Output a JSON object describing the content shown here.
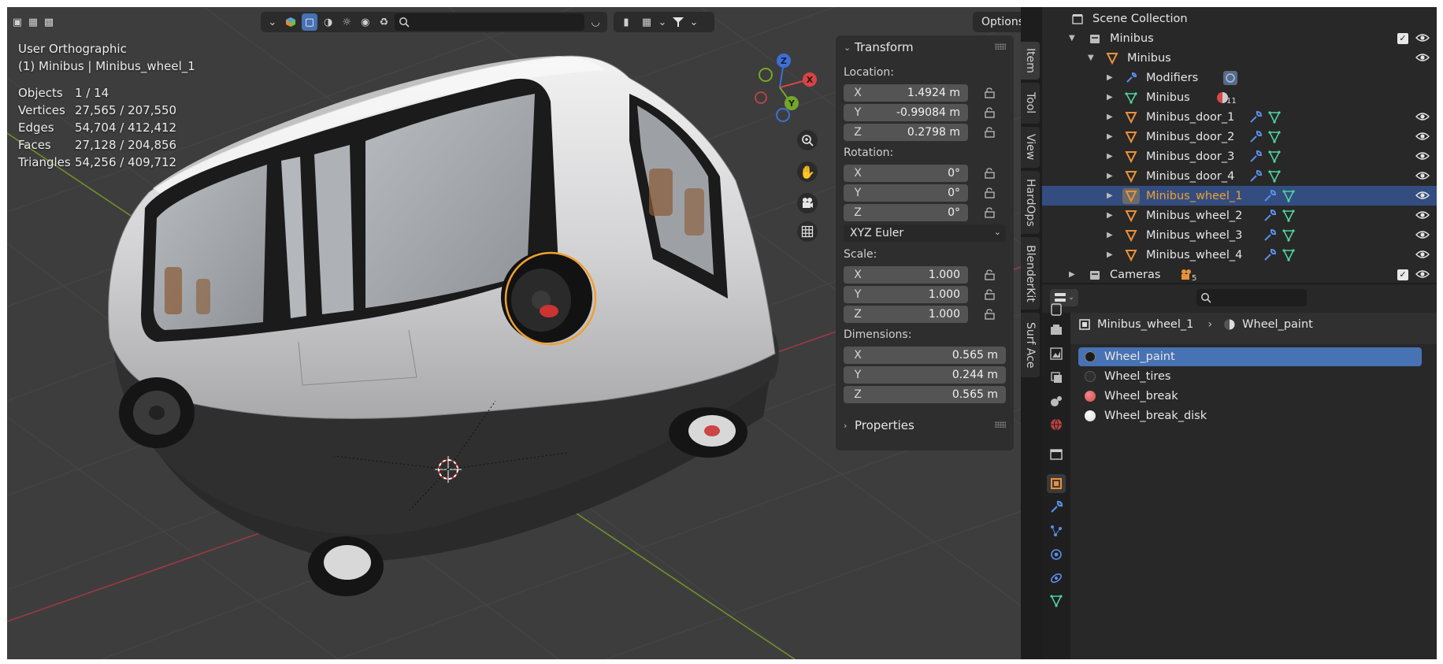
{
  "viewport": {
    "view_name": "User Orthographic",
    "active_object": "(1) Minibus | Minibus_wheel_1",
    "stats": [
      {
        "key": "Objects",
        "value": "1 / 14"
      },
      {
        "key": "Vertices",
        "value": "27,565 / 207,550"
      },
      {
        "key": "Edges",
        "value": "54,704 / 412,412"
      },
      {
        "key": "Faces",
        "value": "27,128 / 204,856"
      },
      {
        "key": "Triangles",
        "value": "54,256 / 409,712"
      }
    ],
    "options_label": "Options",
    "gizmo": {
      "x": "X",
      "y": "Y",
      "z": "Z"
    }
  },
  "npanel": {
    "transform_title": "Transform",
    "location_label": "Location:",
    "location": [
      {
        "axis": "X",
        "value": "1.4924 m"
      },
      {
        "axis": "Y",
        "value": "-0.99084 m"
      },
      {
        "axis": "Z",
        "value": "0.2798 m"
      }
    ],
    "rotation_label": "Rotation:",
    "rotation": [
      {
        "axis": "X",
        "value": "0°"
      },
      {
        "axis": "Y",
        "value": "0°"
      },
      {
        "axis": "Z",
        "value": "0°"
      }
    ],
    "rotation_mode": "XYZ Euler",
    "scale_label": "Scale:",
    "scale": [
      {
        "axis": "X",
        "value": "1.000"
      },
      {
        "axis": "Y",
        "value": "1.000"
      },
      {
        "axis": "Z",
        "value": "1.000"
      }
    ],
    "dimensions_label": "Dimensions:",
    "dimensions": [
      {
        "axis": "X",
        "value": "0.565 m"
      },
      {
        "axis": "Y",
        "value": "0.244 m"
      },
      {
        "axis": "Z",
        "value": "0.565 m"
      }
    ],
    "properties_title": "Properties"
  },
  "side_tabs": [
    "Item",
    "Tool",
    "View",
    "HardOps",
    "BlenderKit",
    "Surf Ace"
  ],
  "outliner": {
    "rows": [
      {
        "label": "Scene Collection"
      },
      {
        "label": "Minibus"
      },
      {
        "label": "Minibus"
      },
      {
        "label": "Modifiers"
      },
      {
        "label": "Minibus",
        "badge": "11"
      },
      {
        "label": "Minibus_door_1"
      },
      {
        "label": "Minibus_door_2"
      },
      {
        "label": "Minibus_door_3"
      },
      {
        "label": "Minibus_door_4"
      },
      {
        "label": "Minibus_wheel_1"
      },
      {
        "label": "Minibus_wheel_2"
      },
      {
        "label": "Minibus_wheel_3"
      },
      {
        "label": "Minibus_wheel_4"
      },
      {
        "label": "Cameras",
        "badge": "5"
      }
    ]
  },
  "properties": {
    "breadcrumb_object": "Minibus_wheel_1",
    "breadcrumb_material": "Wheel_paint",
    "materials": [
      {
        "name": "Wheel_paint",
        "color": "#1c1c1c"
      },
      {
        "name": "Wheel_tires",
        "color": "#303030"
      },
      {
        "name": "Wheel_break",
        "color": "#d94848"
      },
      {
        "name": "Wheel_break_disk",
        "color": "#f2f2f2"
      }
    ]
  },
  "colors": {
    "accent": "#4772b3",
    "selection_orange": "#f0a030",
    "outliner_selected": "#334d80",
    "object_icon": "#e8913a",
    "mesh_icon": "#4fd1a0",
    "modifier_icon": "#5a8ee8"
  }
}
